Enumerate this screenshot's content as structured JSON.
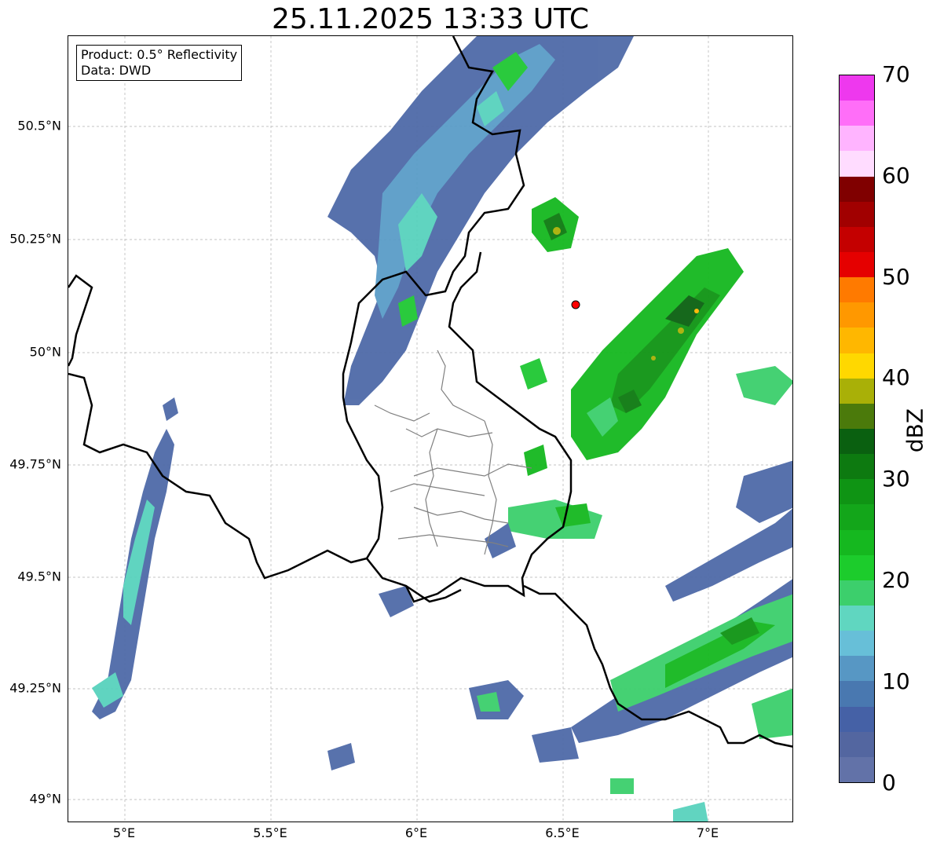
{
  "title": "25.11.2025 13:33 UTC",
  "info_box": {
    "product": "Product: 0.5° Reflectivity",
    "data": "Data: DWD"
  },
  "map": {
    "lat_labels": [
      "50.5°N",
      "50.25°N",
      "50°N",
      "49.75°N",
      "49.5°N",
      "49.25°N",
      "49°N"
    ],
    "lon_labels": [
      "5°E",
      "5.5°E",
      "6°E",
      "6.5°E",
      "7°E"
    ],
    "radar_site_marker_color": "#ff0000"
  },
  "colorbar": {
    "label": "dBZ",
    "ticks": [
      "0",
      "10",
      "20",
      "30",
      "40",
      "50",
      "60",
      "70"
    ],
    "colors": [
      "#6272a8",
      "#5366a0",
      "#4561a6",
      "#4978b0",
      "#5797c4",
      "#67bfd8",
      "#60d6c0",
      "#3ccf6c",
      "#1ccc2c",
      "#15b81f",
      "#13a61a",
      "#0f9414",
      "#0d7a10",
      "#0a6010",
      "#4b7a0b",
      "#a9b007",
      "#ffd800",
      "#ffb700",
      "#ff9800",
      "#ff7a00",
      "#e50000",
      "#c40000",
      "#a10000",
      "#800000",
      "#ffdcff",
      "#ffb4ff",
      "#ff6ef8",
      "#ee38ee"
    ]
  }
}
